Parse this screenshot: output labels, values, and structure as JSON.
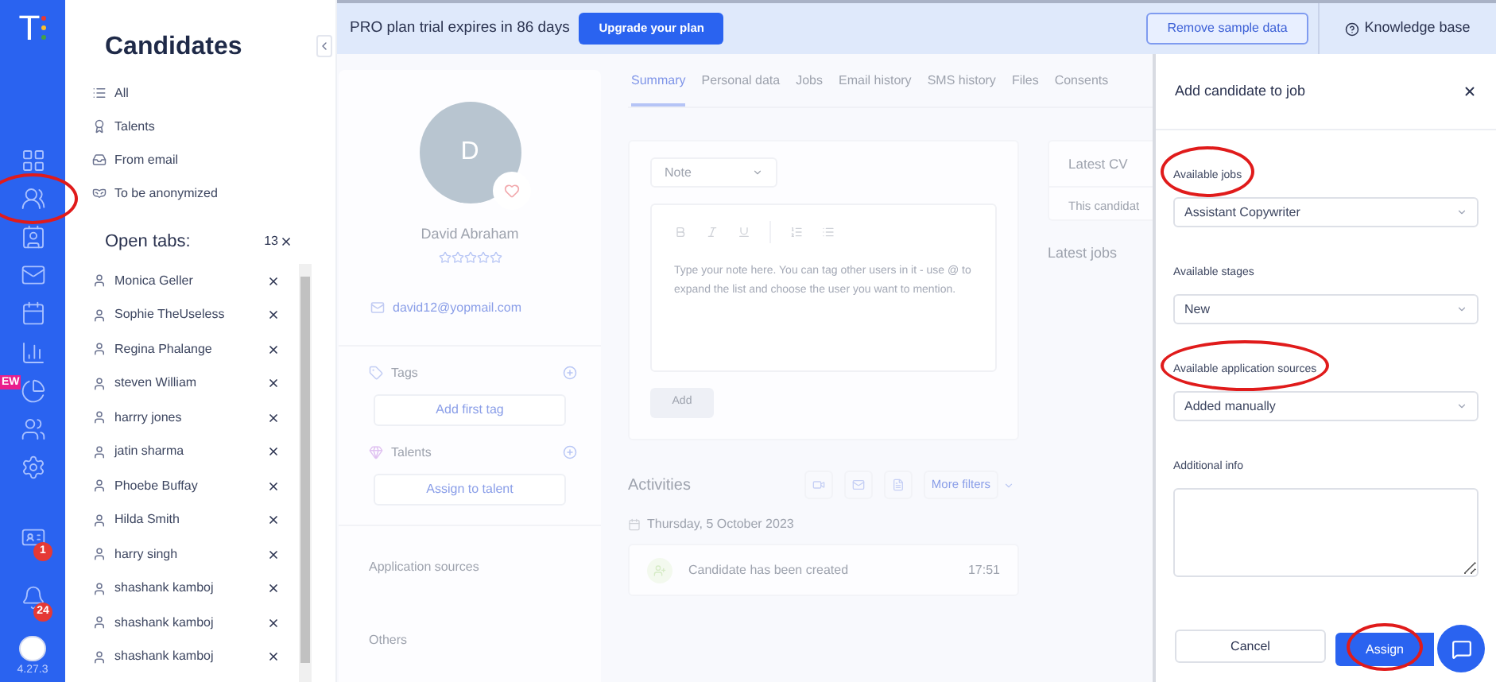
{
  "rail": {
    "logo": "T",
    "items": [
      {
        "circled": false
      },
      {
        "circled": true
      },
      {
        "circled": false
      },
      {
        "circled": false
      },
      {
        "circled": false
      },
      {
        "circled": false
      },
      {
        "circled": false,
        "tag": "EW"
      },
      {
        "circled": false
      },
      {
        "circled": false
      },
      {
        "circled": false,
        "badge": "1"
      },
      {
        "circled": false,
        "badge": "24"
      }
    ],
    "version": "4.27.3"
  },
  "candidates": {
    "title": "Candidates",
    "filters": [
      "All",
      "Talents",
      "From email",
      "To be anonymized"
    ],
    "open_tabs_label": "Open tabs:",
    "open_tabs_count": "13",
    "open_tabs": [
      "Monica Geller",
      "Sophie TheUseless",
      "Regina Phalange",
      "steven William",
      "harrry jones",
      "jatin sharma",
      "Phoebe Buffay",
      "Hilda Smith",
      "harry singh",
      "shashank kamboj",
      "shashank kamboj",
      "shashank kamboj"
    ]
  },
  "top_bar": {
    "trial_text": "PRO plan trial expires in 86 days",
    "upgrade_button": "Upgrade your plan",
    "remove_button": "Remove sample data",
    "help_link": "Knowledge base"
  },
  "profile": {
    "initial": "D",
    "name": "David Abraham",
    "stars": 0,
    "email": "david12@yopmail.com",
    "tags_label": "Tags",
    "tags_button": "Add first tag",
    "talents_label": "Talents",
    "talents_button": "Assign to talent",
    "sections": [
      "Application sources",
      "Others"
    ]
  },
  "tabs": [
    {
      "label": "Summary",
      "selected": true
    },
    {
      "label": "Personal data",
      "selected": false
    },
    {
      "label": "Jobs",
      "selected": false
    },
    {
      "label": "Email history",
      "selected": false
    },
    {
      "label": "SMS history",
      "selected": false
    },
    {
      "label": "Files",
      "selected": false
    },
    {
      "label": "Consents",
      "selected": false
    }
  ],
  "note": {
    "type": "Note",
    "placeholder": "Type your note here. You can tag other users in it - use @ to expand the list and choose the user you want to mention.",
    "add_button": "Add"
  },
  "side": {
    "cv_title": "Latest CV",
    "cv_text": "This candidat",
    "jobs_title": "Latest jobs"
  },
  "activities": {
    "title": "Activities",
    "more_filters": "More filters",
    "date": "Thursday, 5 October 2023",
    "items": [
      {
        "text": "Candidate has been created",
        "time": "17:51"
      }
    ]
  },
  "drawer": {
    "title": "Add candidate to job",
    "fields": [
      {
        "kind": "select",
        "label": "Available jobs",
        "value": "Assistant Copywriter",
        "circled": true
      },
      {
        "kind": "select",
        "label": "Available stages",
        "value": "New",
        "circled": false
      },
      {
        "kind": "select",
        "label": "Available application sources",
        "value": "Added manually",
        "circled": true
      },
      {
        "kind": "textarea",
        "label": "Additional info",
        "circled": false
      }
    ],
    "cancel_button": "Cancel",
    "assign_button": {
      "label": "Assign",
      "circled": true
    }
  }
}
